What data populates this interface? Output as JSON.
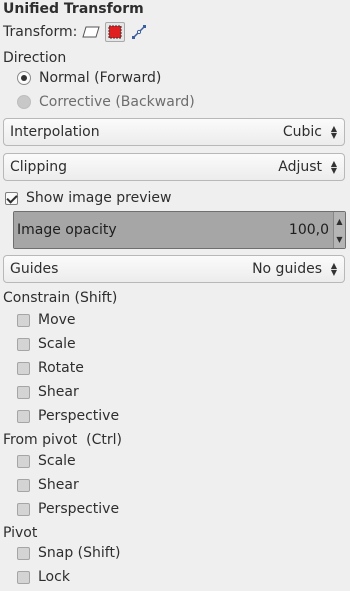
{
  "title": "Unified Transform",
  "transform": {
    "label": "Transform:",
    "modes": [
      "layer",
      "selection",
      "path"
    ],
    "active_mode": "selection"
  },
  "direction": {
    "label": "Direction",
    "options": [
      {
        "label": "Normal (Forward)",
        "selected": true
      },
      {
        "label": "Corrective (Backward)",
        "selected": false
      }
    ]
  },
  "interpolation": {
    "label": "Interpolation",
    "value": "Cubic"
  },
  "clipping": {
    "label": "Clipping",
    "value": "Adjust"
  },
  "show_image_preview": {
    "label": "Show image preview",
    "checked": true
  },
  "image_opacity": {
    "label": "Image opacity",
    "value": "100,0",
    "fraction": 1.0
  },
  "guides": {
    "label": "Guides",
    "value": "No guides"
  },
  "constrain": {
    "label": "Constrain (Shift)",
    "items": [
      {
        "label": "Move",
        "checked": false
      },
      {
        "label": "Scale",
        "checked": false
      },
      {
        "label": "Rotate",
        "checked": false
      },
      {
        "label": "Shear",
        "checked": false
      },
      {
        "label": "Perspective",
        "checked": false
      }
    ]
  },
  "from_pivot": {
    "label": "From pivot  (Ctrl)",
    "items": [
      {
        "label": "Scale",
        "checked": false
      },
      {
        "label": "Shear",
        "checked": false
      },
      {
        "label": "Perspective",
        "checked": false
      }
    ]
  },
  "pivot": {
    "label": "Pivot",
    "items": [
      {
        "label": "Snap (Shift)",
        "checked": false
      },
      {
        "label": "Lock",
        "checked": false
      }
    ]
  },
  "colors": {
    "selection_red": "#e02020",
    "background": "#efefef"
  }
}
